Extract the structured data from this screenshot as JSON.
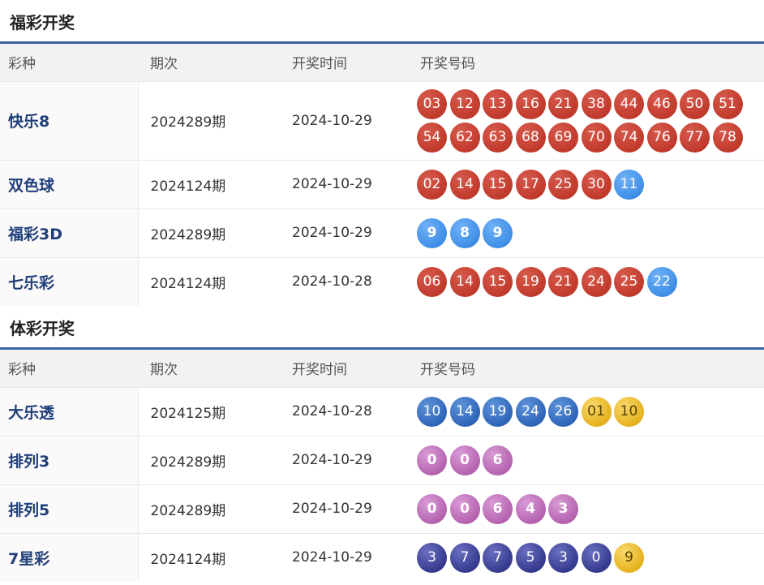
{
  "fucai": {
    "title": "福彩开奖",
    "headers": {
      "name": "彩种",
      "period": "期次",
      "date": "开奖时间",
      "numbers": "开奖号码"
    },
    "rows": [
      {
        "name": "快乐8",
        "period": "2024289期",
        "date": "2024-10-29",
        "height": 97,
        "balls": [
          {
            "n": "03",
            "c": "red"
          },
          {
            "n": "12",
            "c": "red"
          },
          {
            "n": "13",
            "c": "red"
          },
          {
            "n": "16",
            "c": "red"
          },
          {
            "n": "21",
            "c": "red"
          },
          {
            "n": "38",
            "c": "red"
          },
          {
            "n": "44",
            "c": "red"
          },
          {
            "n": "46",
            "c": "red"
          },
          {
            "n": "50",
            "c": "red"
          },
          {
            "n": "51",
            "c": "red"
          },
          {
            "n": "54",
            "c": "red"
          },
          {
            "n": "62",
            "c": "red"
          },
          {
            "n": "63",
            "c": "red"
          },
          {
            "n": "68",
            "c": "red"
          },
          {
            "n": "69",
            "c": "red"
          },
          {
            "n": "70",
            "c": "red"
          },
          {
            "n": "74",
            "c": "red"
          },
          {
            "n": "76",
            "c": "red"
          },
          {
            "n": "77",
            "c": "red"
          },
          {
            "n": "78",
            "c": "red"
          }
        ]
      },
      {
        "name": "双色球",
        "period": "2024124期",
        "date": "2024-10-29",
        "height": 60,
        "balls": [
          {
            "n": "02",
            "c": "red"
          },
          {
            "n": "14",
            "c": "red"
          },
          {
            "n": "15",
            "c": "red"
          },
          {
            "n": "17",
            "c": "red"
          },
          {
            "n": "25",
            "c": "red"
          },
          {
            "n": "30",
            "c": "red"
          },
          {
            "n": "11",
            "c": "blue"
          }
        ]
      },
      {
        "name": "福彩3D",
        "period": "2024289期",
        "date": "2024-10-29",
        "height": 60,
        "balls": [
          {
            "n": "9",
            "c": "blue bold"
          },
          {
            "n": "8",
            "c": "blue bold"
          },
          {
            "n": "9",
            "c": "blue bold"
          }
        ]
      },
      {
        "name": "七乐彩",
        "period": "2024124期",
        "date": "2024-10-28",
        "height": 60,
        "balls": [
          {
            "n": "06",
            "c": "red"
          },
          {
            "n": "14",
            "c": "red"
          },
          {
            "n": "15",
            "c": "red"
          },
          {
            "n": "19",
            "c": "red"
          },
          {
            "n": "21",
            "c": "red"
          },
          {
            "n": "24",
            "c": "red"
          },
          {
            "n": "25",
            "c": "red"
          },
          {
            "n": "22",
            "c": "blue"
          }
        ]
      }
    ]
  },
  "ticai": {
    "title": "体彩开奖",
    "headers": {
      "name": "彩种",
      "period": "期次",
      "date": "开奖时间",
      "numbers": "开奖号码"
    },
    "rows": [
      {
        "name": "大乐透",
        "period": "2024125期",
        "date": "2024-10-28",
        "height": 60,
        "balls": [
          {
            "n": "10",
            "c": "darkblue"
          },
          {
            "n": "14",
            "c": "darkblue"
          },
          {
            "n": "19",
            "c": "darkblue"
          },
          {
            "n": "24",
            "c": "darkblue"
          },
          {
            "n": "26",
            "c": "darkblue"
          },
          {
            "n": "01",
            "c": "yellow"
          },
          {
            "n": "10",
            "c": "yellow"
          }
        ]
      },
      {
        "name": "排列3",
        "period": "2024289期",
        "date": "2024-10-29",
        "height": 60,
        "balls": [
          {
            "n": "0",
            "c": "purple"
          },
          {
            "n": "0",
            "c": "purple"
          },
          {
            "n": "6",
            "c": "purple"
          }
        ]
      },
      {
        "name": "排列5",
        "period": "2024289期",
        "date": "2024-10-29",
        "height": 60,
        "balls": [
          {
            "n": "0",
            "c": "purple"
          },
          {
            "n": "0",
            "c": "purple"
          },
          {
            "n": "6",
            "c": "purple"
          },
          {
            "n": "4",
            "c": "purple"
          },
          {
            "n": "3",
            "c": "purple"
          }
        ]
      },
      {
        "name": "7星彩",
        "period": "2024124期",
        "date": "2024-10-29",
        "height": 60,
        "balls": [
          {
            "n": "3",
            "c": "navy"
          },
          {
            "n": "7",
            "c": "navy"
          },
          {
            "n": "7",
            "c": "navy"
          },
          {
            "n": "5",
            "c": "navy"
          },
          {
            "n": "3",
            "c": "navy"
          },
          {
            "n": "0",
            "c": "navy"
          },
          {
            "n": "9",
            "c": "yellow"
          }
        ]
      }
    ]
  }
}
